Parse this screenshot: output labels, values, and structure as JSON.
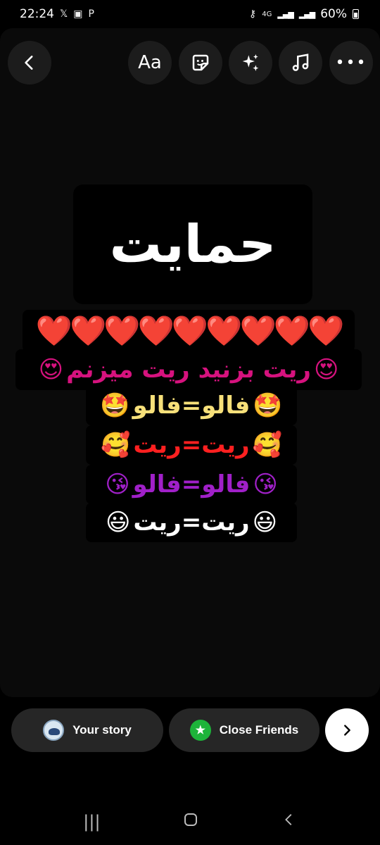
{
  "status": {
    "time": "22:24",
    "battery": "60%",
    "network": "4G"
  },
  "toolbar": {
    "text_label": "Aa"
  },
  "story": {
    "title": "حمایت",
    "hearts": "❤️❤️❤️❤️❤️❤️❤️❤️❤️",
    "line2": "ریت بزنید ریت میزنم",
    "line3": "فالو=فالو",
    "line4": "ریت=ریت",
    "line5": "فالو=فالو",
    "line6": "ریت=ریت",
    "emojis": {
      "line2": "😍",
      "line3": "🤩",
      "line4": "🥰",
      "line5": "😘",
      "line6": "😃"
    }
  },
  "share": {
    "your_story": "Your story",
    "close_friends": "Close Friends"
  },
  "colors": {
    "hearts": "#e01923",
    "line2": "#d6127e",
    "line3": "#f7e07a",
    "line4": "#ff2020",
    "line5": "#a020c8",
    "line6": "#ffffff"
  }
}
